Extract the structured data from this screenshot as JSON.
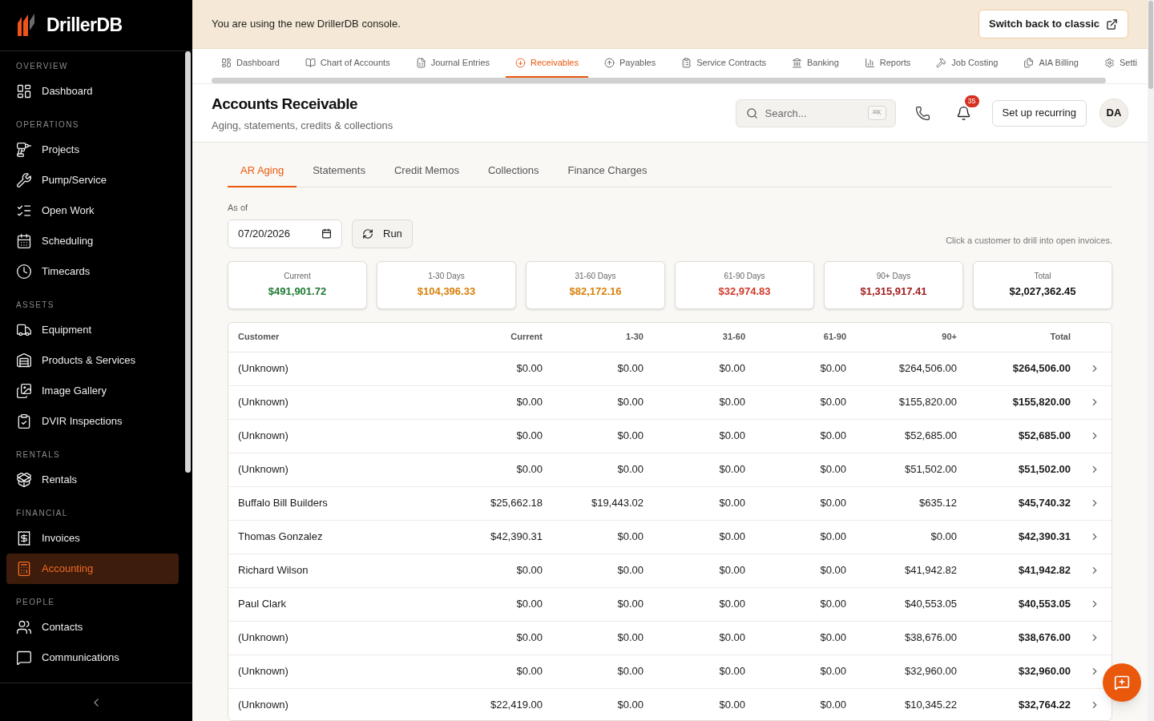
{
  "sidebar": {
    "brand": "DrillerDB",
    "sections": [
      {
        "label": "OVERVIEW",
        "items": [
          {
            "label": "Dashboard",
            "selected": false
          }
        ]
      },
      {
        "label": "OPERATIONS",
        "items": [
          {
            "label": "Projects",
            "selected": false
          },
          {
            "label": "Pump/Service",
            "selected": false
          },
          {
            "label": "Open Work",
            "selected": false
          },
          {
            "label": "Scheduling",
            "selected": false
          },
          {
            "label": "Timecards",
            "selected": false
          }
        ]
      },
      {
        "label": "ASSETS",
        "items": [
          {
            "label": "Equipment",
            "selected": false
          },
          {
            "label": "Products & Services",
            "selected": false
          },
          {
            "label": "Image Gallery",
            "selected": false
          },
          {
            "label": "DVIR Inspections",
            "selected": false
          }
        ]
      },
      {
        "label": "RENTALS",
        "items": [
          {
            "label": "Rentals",
            "selected": false
          }
        ]
      },
      {
        "label": "FINANCIAL",
        "items": [
          {
            "label": "Invoices",
            "selected": false
          },
          {
            "label": "Accounting",
            "selected": true
          }
        ]
      },
      {
        "label": "PEOPLE",
        "items": [
          {
            "label": "Contacts",
            "selected": false
          },
          {
            "label": "Communications",
            "selected": false
          }
        ]
      }
    ]
  },
  "banner": {
    "message": "You are using the new DrillerDB console.",
    "button": "Switch back to classic"
  },
  "top_tabs": [
    {
      "label": "Dashboard",
      "selected": false
    },
    {
      "label": "Chart of Accounts",
      "selected": false
    },
    {
      "label": "Journal Entries",
      "selected": false
    },
    {
      "label": "Receivables",
      "selected": true
    },
    {
      "label": "Payables",
      "selected": false
    },
    {
      "label": "Service Contracts",
      "selected": false
    },
    {
      "label": "Banking",
      "selected": false
    },
    {
      "label": "Reports",
      "selected": false
    },
    {
      "label": "Job Costing",
      "selected": false
    },
    {
      "label": "AIA Billing",
      "selected": false
    },
    {
      "label": "Setti",
      "selected": false
    }
  ],
  "header": {
    "title": "Accounts Receivable",
    "subtitle": "Aging, statements, credits & collections",
    "search": {
      "placeholder": "Search...",
      "shortcut": "⌘K"
    },
    "notification_count": "35",
    "button": "Set up recurring",
    "avatar": "DA"
  },
  "sub_tabs": [
    {
      "label": "AR Aging",
      "selected": true
    },
    {
      "label": "Statements",
      "selected": false
    },
    {
      "label": "Credit Memos",
      "selected": false
    },
    {
      "label": "Collections",
      "selected": false
    },
    {
      "label": "Finance Charges",
      "selected": false
    }
  ],
  "filter": {
    "label": "As of",
    "date": "07/20/2026",
    "run_button": "Run",
    "hint": "Click a customer to drill into open invoices."
  },
  "summary": [
    {
      "label": "Current",
      "value": "$491,901.72",
      "color": "#1e7a34"
    },
    {
      "label": "1-30 Days",
      "value": "$104,396.33",
      "color": "#d9800b"
    },
    {
      "label": "31-60 Days",
      "value": "$82,172.16",
      "color": "#d9800b"
    },
    {
      "label": "61-90 Days",
      "value": "$32,974.83",
      "color": "#cf3b2a"
    },
    {
      "label": "90+ Days",
      "value": "$1,315,917.41",
      "color": "#a11d1d"
    },
    {
      "label": "Total",
      "value": "$2,027,362.45",
      "color": "#111111"
    }
  ],
  "table": {
    "columns": [
      "Customer",
      "Current",
      "1-30",
      "31-60",
      "61-90",
      "90+",
      "Total"
    ],
    "rows": [
      {
        "cells": [
          "(Unknown)",
          "$0.00",
          "$0.00",
          "$0.00",
          "$0.00",
          "$264,506.00",
          "$264,506.00"
        ]
      },
      {
        "cells": [
          "(Unknown)",
          "$0.00",
          "$0.00",
          "$0.00",
          "$0.00",
          "$155,820.00",
          "$155,820.00"
        ]
      },
      {
        "cells": [
          "(Unknown)",
          "$0.00",
          "$0.00",
          "$0.00",
          "$0.00",
          "$52,685.00",
          "$52,685.00"
        ]
      },
      {
        "cells": [
          "(Unknown)",
          "$0.00",
          "$0.00",
          "$0.00",
          "$0.00",
          "$51,502.00",
          "$51,502.00"
        ]
      },
      {
        "cells": [
          "Buffalo Bill Builders",
          "$25,662.18",
          "$19,443.02",
          "$0.00",
          "$0.00",
          "$635.12",
          "$45,740.32"
        ]
      },
      {
        "cells": [
          "Thomas Gonzalez",
          "$42,390.31",
          "$0.00",
          "$0.00",
          "$0.00",
          "$0.00",
          "$42,390.31"
        ]
      },
      {
        "cells": [
          "Richard Wilson",
          "$0.00",
          "$0.00",
          "$0.00",
          "$0.00",
          "$41,942.82",
          "$41,942.82"
        ]
      },
      {
        "cells": [
          "Paul Clark",
          "$0.00",
          "$0.00",
          "$0.00",
          "$0.00",
          "$40,553.05",
          "$40,553.05"
        ]
      },
      {
        "cells": [
          "(Unknown)",
          "$0.00",
          "$0.00",
          "$0.00",
          "$0.00",
          "$38,676.00",
          "$38,676.00"
        ]
      },
      {
        "cells": [
          "(Unknown)",
          "$0.00",
          "$0.00",
          "$0.00",
          "$0.00",
          "$32,960.00",
          "$32,960.00"
        ]
      },
      {
        "cells": [
          "(Unknown)",
          "$22,419.00",
          "$0.00",
          "$0.00",
          "$0.00",
          "$10,345.22",
          "$32,764.22"
        ]
      }
    ]
  }
}
